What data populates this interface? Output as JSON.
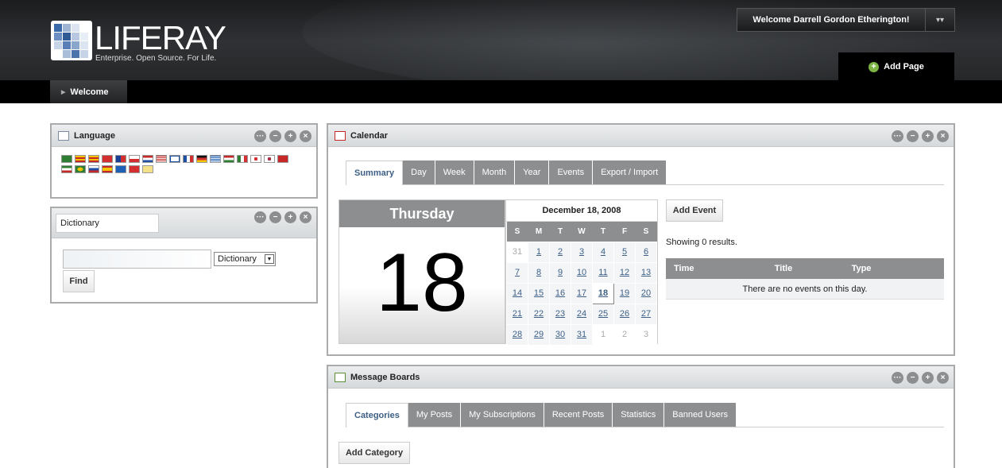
{
  "header": {
    "logo_word": "LIFERAY",
    "logo_tagline": "Enterprise. Open Source. For Life.",
    "welcome_text": "Welcome Darrell Gordon Etherington!",
    "add_page": "Add Page",
    "nav_tab": "Welcome"
  },
  "language_portlet": {
    "title": "Language",
    "flags": [
      "Arabic",
      "Catalan",
      "Catalan-2",
      "Chinese",
      "Chinese-TW",
      "Czech",
      "Dutch",
      "English",
      "Finnish",
      "French",
      "German",
      "Greek",
      "Hungarian",
      "Italian",
      "Japanese",
      "Korean",
      "Norwegian",
      "Persian",
      "Portuguese",
      "Russian",
      "Spanish",
      "Swedish",
      "Turkish",
      "Vietnamese"
    ]
  },
  "dictionary_portlet": {
    "title": "Dictionary",
    "search_value": "",
    "select_value": "Dictionary",
    "find_label": "Find"
  },
  "calendar_portlet": {
    "title": "Calendar",
    "tabs": [
      "Summary",
      "Day",
      "Week",
      "Month",
      "Year",
      "Events",
      "Export / Import"
    ],
    "day_name": "Thursday",
    "day_number": "18",
    "month_title": "December 18, 2008",
    "weekdays": [
      "S",
      "M",
      "T",
      "W",
      "T",
      "F",
      "S"
    ],
    "weeks": [
      [
        "31",
        "1",
        "2",
        "3",
        "4",
        "5",
        "6"
      ],
      [
        "7",
        "8",
        "9",
        "10",
        "11",
        "12",
        "13"
      ],
      [
        "14",
        "15",
        "16",
        "17",
        "18",
        "19",
        "20"
      ],
      [
        "21",
        "22",
        "23",
        "24",
        "25",
        "26",
        "27"
      ],
      [
        "28",
        "29",
        "30",
        "31",
        "1",
        "2",
        "3"
      ]
    ],
    "add_event": "Add Event",
    "showing": "Showing 0 results.",
    "columns": [
      "Time",
      "Title",
      "Type"
    ],
    "empty": "There are no events on this day."
  },
  "message_boards": {
    "title": "Message Boards",
    "tabs": [
      "Categories",
      "My Posts",
      "My Subscriptions",
      "Recent Posts",
      "Statistics",
      "Banned Users"
    ],
    "add_category": "Add Category"
  },
  "colors": {
    "accent": "#3d5f86",
    "tab_gray": "#8c8e90",
    "header_dark": "#1b1c1e",
    "add_green": "#7cb342"
  }
}
